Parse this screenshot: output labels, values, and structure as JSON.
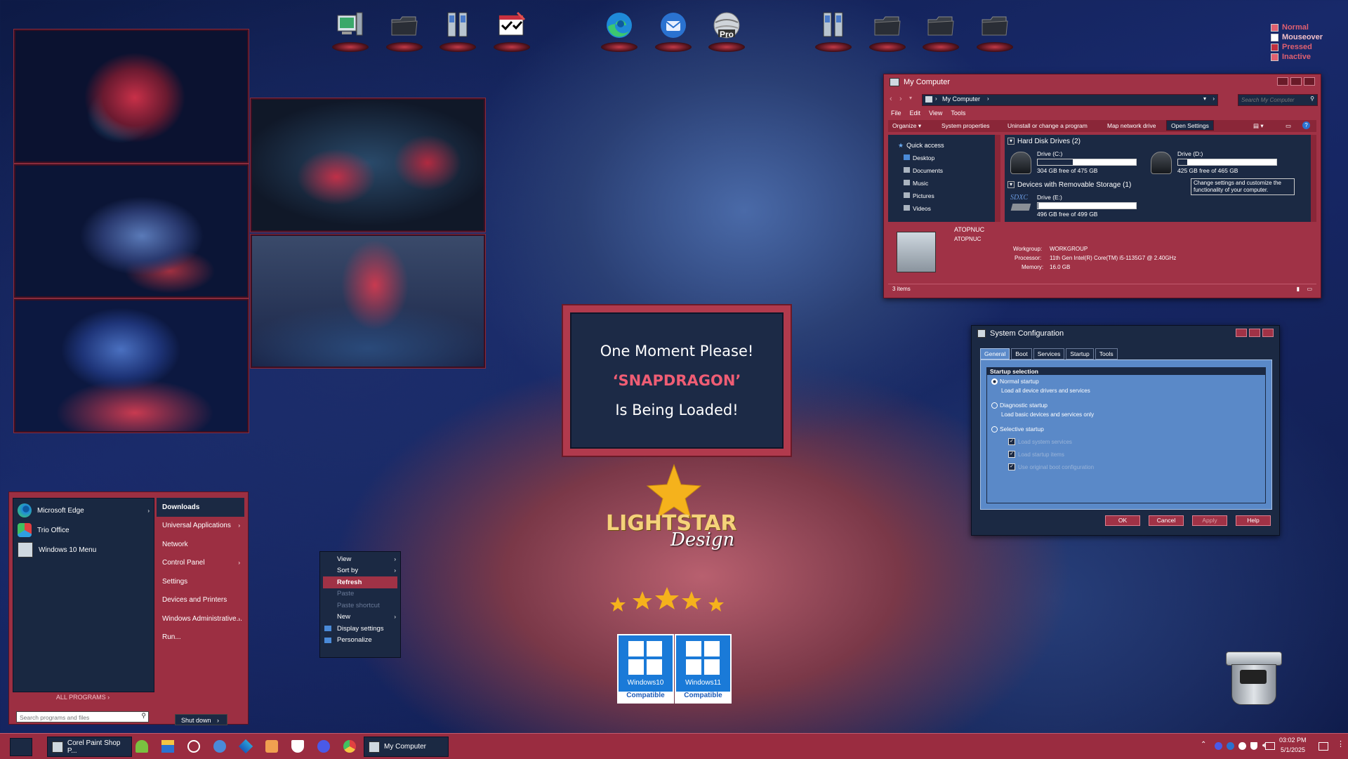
{
  "colors": {
    "accent": "#a03246",
    "panel": "#1b2943",
    "highlight": "#ef5d74",
    "desktop": "#18296a",
    "sysconfig_blue": "#5a89c8"
  },
  "dock": {
    "icons": [
      "computer-icon",
      "folder-icon",
      "drives-icon",
      "checklist-icon",
      "edge-icon",
      "thunderbird-icon",
      "pro-disc-icon",
      "drives-icon",
      "folder-icon",
      "folder-icon",
      "folder-icon"
    ],
    "pro_label": "Pro"
  },
  "legend": [
    {
      "label": "Normal",
      "color": "#e06070"
    },
    {
      "label": "Mouseover",
      "color": "#ffffff"
    },
    {
      "label": "Pressed",
      "color": "#c03040"
    },
    {
      "label": "Inactive",
      "color": "#e06070"
    }
  ],
  "splash": {
    "line1": "One Moment Please!",
    "line2": "‘SNAPDRAGON’",
    "line3": "Is Being Loaded!"
  },
  "logo": {
    "brand": "LIGHTSTAR",
    "script": "Design"
  },
  "badges": [
    {
      "line1": "Windows10",
      "line2": "Compatible"
    },
    {
      "line1": "Windows11",
      "line2": "Compatible"
    }
  ],
  "explorer": {
    "title": "My Computer",
    "address": "My Computer",
    "search_placeholder": "Search My Computer",
    "menu": [
      "File",
      "Edit",
      "View",
      "Tools"
    ],
    "toolbar": [
      "Organize",
      "System properties",
      "Uninstall or change a program",
      "Map network drive",
      "Open Settings"
    ],
    "nav": [
      "Quick access",
      "Desktop",
      "Documents",
      "Music",
      "Pictures",
      "Videos"
    ],
    "group_hdd": "Hard Disk Drives (2)",
    "group_removable": "Devices with Removable Storage (1)",
    "drives": [
      {
        "name": "Drive (C:)",
        "free": "304 GB free of 475 GB",
        "used_fraction": 0.36
      },
      {
        "name": "Drive (D:)",
        "free": "425 GB free of 465 GB",
        "used_fraction": 0.09
      },
      {
        "name": "Drive (E:)",
        "free": "496 GB free of 499 GB",
        "used_fraction": 0.01
      }
    ],
    "sdxc_label": "SDXC",
    "tooltip": "Change settings and customize the functionality of your computer.",
    "details": {
      "name": "ATOPNUC",
      "name2": "ATOPNUC",
      "workgroup_label": "Workgroup:",
      "workgroup": "WORKGROUP",
      "processor_label": "Processor:",
      "processor": "11th Gen Intel(R) Core(TM) i5-1135G7 @ 2.40GHz",
      "memory_label": "Memory:",
      "memory": "16.0 GB"
    },
    "status": "3 items"
  },
  "sysconfig": {
    "title": "System Configuration",
    "tabs": [
      "General",
      "Boot",
      "Services",
      "Startup",
      "Tools"
    ],
    "group": "Startup selection",
    "normal": "Normal startup",
    "normal_desc": "Load all device drivers and services",
    "diagnostic": "Diagnostic startup",
    "diagnostic_desc": "Load basic devices and services only",
    "selective": "Selective startup",
    "checks": [
      "Load system services",
      "Load startup items",
      "Use original boot configuration"
    ],
    "buttons": [
      "OK",
      "Cancel",
      "Apply",
      "Help"
    ]
  },
  "start_menu": {
    "pinned": [
      "Microsoft Edge",
      "Trio Office",
      "Windows 10 Menu"
    ],
    "right": [
      "Downloads",
      "Universal Applications",
      "Network",
      "Control Panel",
      "Settings",
      "Devices and Printers",
      "Windows Administrative...",
      "Run..."
    ],
    "all_programs": "ALL PROGRAMS",
    "search_placeholder": "Search programs and files",
    "shutdown": "Shut down"
  },
  "context_menu": [
    "View",
    "Sort by",
    "Refresh",
    "Paste",
    "Paste shortcut",
    "New",
    "Display settings",
    "Personalize"
  ],
  "taskbar": {
    "app1": "Corel Paint Shop P...",
    "app2": "My Computer",
    "time": "03:02 PM",
    "date": "5/1/2025"
  }
}
